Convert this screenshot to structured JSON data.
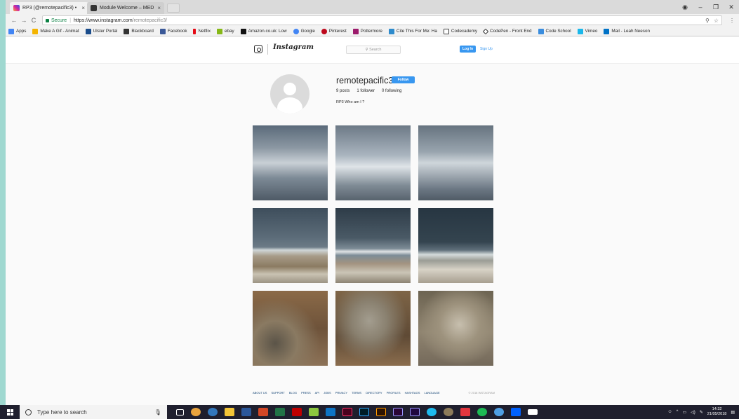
{
  "browser": {
    "tabs": [
      {
        "title": "RP3 (@remotepacific3) • ",
        "icon": "instagram-icon",
        "active": true
      },
      {
        "title": "Module Welcome – MED",
        "icon": "blackboard-icon",
        "active": false
      }
    ],
    "address": {
      "secure_label": "Secure",
      "url_host": "https://www.instagram.com",
      "url_path": "/remotepacific3/"
    },
    "bookmarks": [
      {
        "label": "Apps",
        "icon": "apps-grid-icon",
        "color": "#4285f4"
      },
      {
        "label": "Make A Gif - Animat",
        "icon": "gif-icon",
        "color": "#f4b400"
      },
      {
        "label": "Ulster Portal",
        "icon": "ulster-icon",
        "color": "#1a4c8b"
      },
      {
        "label": "Blackboard",
        "icon": "blackboard-icon",
        "color": "#333333"
      },
      {
        "label": "Facebook",
        "icon": "facebook-icon",
        "color": "#3b5998"
      },
      {
        "label": "Netflix",
        "icon": "netflix-icon",
        "color": "#e50914"
      },
      {
        "label": "ebay",
        "icon": "ebay-icon",
        "color": "#86b817"
      },
      {
        "label": "Amazon.co.uk: Low",
        "icon": "amazon-icon",
        "color": "#111111"
      },
      {
        "label": "Google",
        "icon": "google-icon",
        "color": "#4285f4"
      },
      {
        "label": "Pinterest",
        "icon": "pinterest-icon",
        "color": "#bd081c"
      },
      {
        "label": "Pottermore",
        "icon": "pottermore-icon",
        "color": "#9c1b6c"
      },
      {
        "label": "Cite This For Me: Ha",
        "icon": "citethisforme-icon",
        "color": "#2e8bcc"
      },
      {
        "label": "Codecademy",
        "icon": "codecademy-icon",
        "color": "#444444"
      },
      {
        "label": "CodePen - Front End",
        "icon": "codepen-icon",
        "color": "#333333"
      },
      {
        "label": "Code School",
        "icon": "codeschool-icon",
        "color": "#3a8dde"
      },
      {
        "label": "Vimeo",
        "icon": "vimeo-icon",
        "color": "#1ab7ea"
      },
      {
        "label": "Mail - Leah Neeson",
        "icon": "outlook-icon",
        "color": "#0072c6"
      }
    ]
  },
  "instagram": {
    "wordmark": "Instagram",
    "search_placeholder": "Search",
    "login_label": "Log In",
    "signup_label": "Sign Up",
    "profile": {
      "username": "remotepacific3",
      "follow_label": "Follow",
      "posts": "9 posts",
      "followers": "1 follower",
      "following": "0 following",
      "bio": "RP3 Who am I ?"
    },
    "posts": [
      {
        "kind": "sky-1"
      },
      {
        "kind": "sky-2"
      },
      {
        "kind": "sky-3"
      },
      {
        "kind": "sea-1"
      },
      {
        "kind": "sea-2"
      },
      {
        "kind": "sea-3"
      },
      {
        "kind": "rock-1"
      },
      {
        "kind": "rock-2"
      },
      {
        "kind": "rock-3"
      }
    ],
    "footer": {
      "links": [
        "ABOUT US",
        "SUPPORT",
        "BLOG",
        "PRESS",
        "API",
        "JOBS",
        "PRIVACY",
        "TERMS",
        "DIRECTORY",
        "PROFILES",
        "HASHTAGS",
        "LANGUAGE"
      ],
      "copyright": "© 2018 INSTAGRAM"
    }
  },
  "taskbar": {
    "search_placeholder": "Type here to search",
    "time": "14:32",
    "date": "21/05/2018"
  }
}
